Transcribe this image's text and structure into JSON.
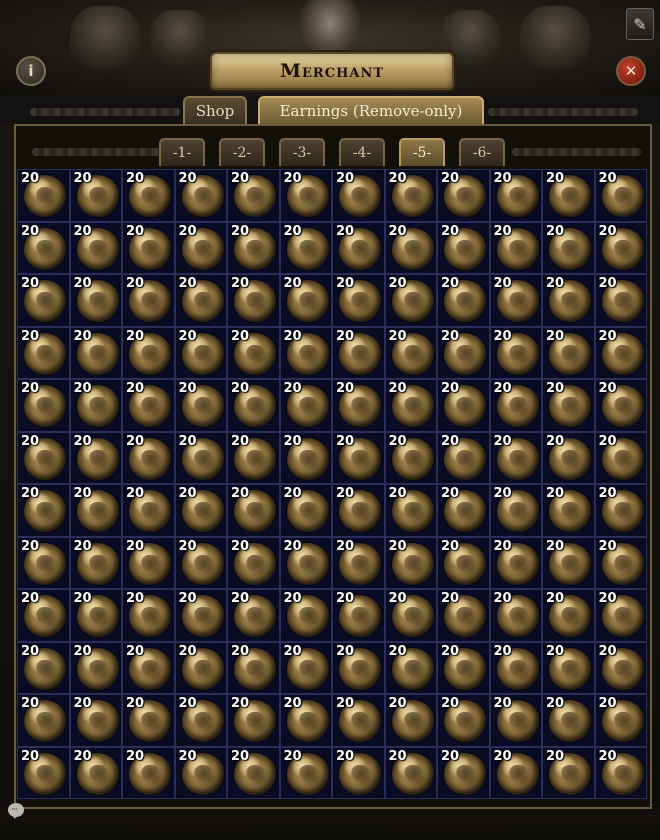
{
  "window": {
    "title": "Merchant",
    "info_icon": "i",
    "close_icon": "✕",
    "edit_icon": "✎"
  },
  "tabs": [
    {
      "label": "Shop",
      "active": false
    },
    {
      "label": "Earnings (Remove-only)",
      "active": true
    }
  ],
  "subtabs": [
    {
      "label": "-1-",
      "active": false
    },
    {
      "label": "-2-",
      "active": false
    },
    {
      "label": "-3-",
      "active": false
    },
    {
      "label": "-4-",
      "active": false
    },
    {
      "label": "-5-",
      "active": true
    },
    {
      "label": "-6-",
      "active": false
    }
  ],
  "grid": {
    "columns": 12,
    "rows": 12,
    "item_icon": "coin-icon",
    "stack_count": "20"
  },
  "colors": {
    "grid_background": "#14163a",
    "title_plate": "#b99d63",
    "close_button": "#c2412c"
  },
  "footer": {
    "chat_icon": "speech-bubble-icon"
  }
}
